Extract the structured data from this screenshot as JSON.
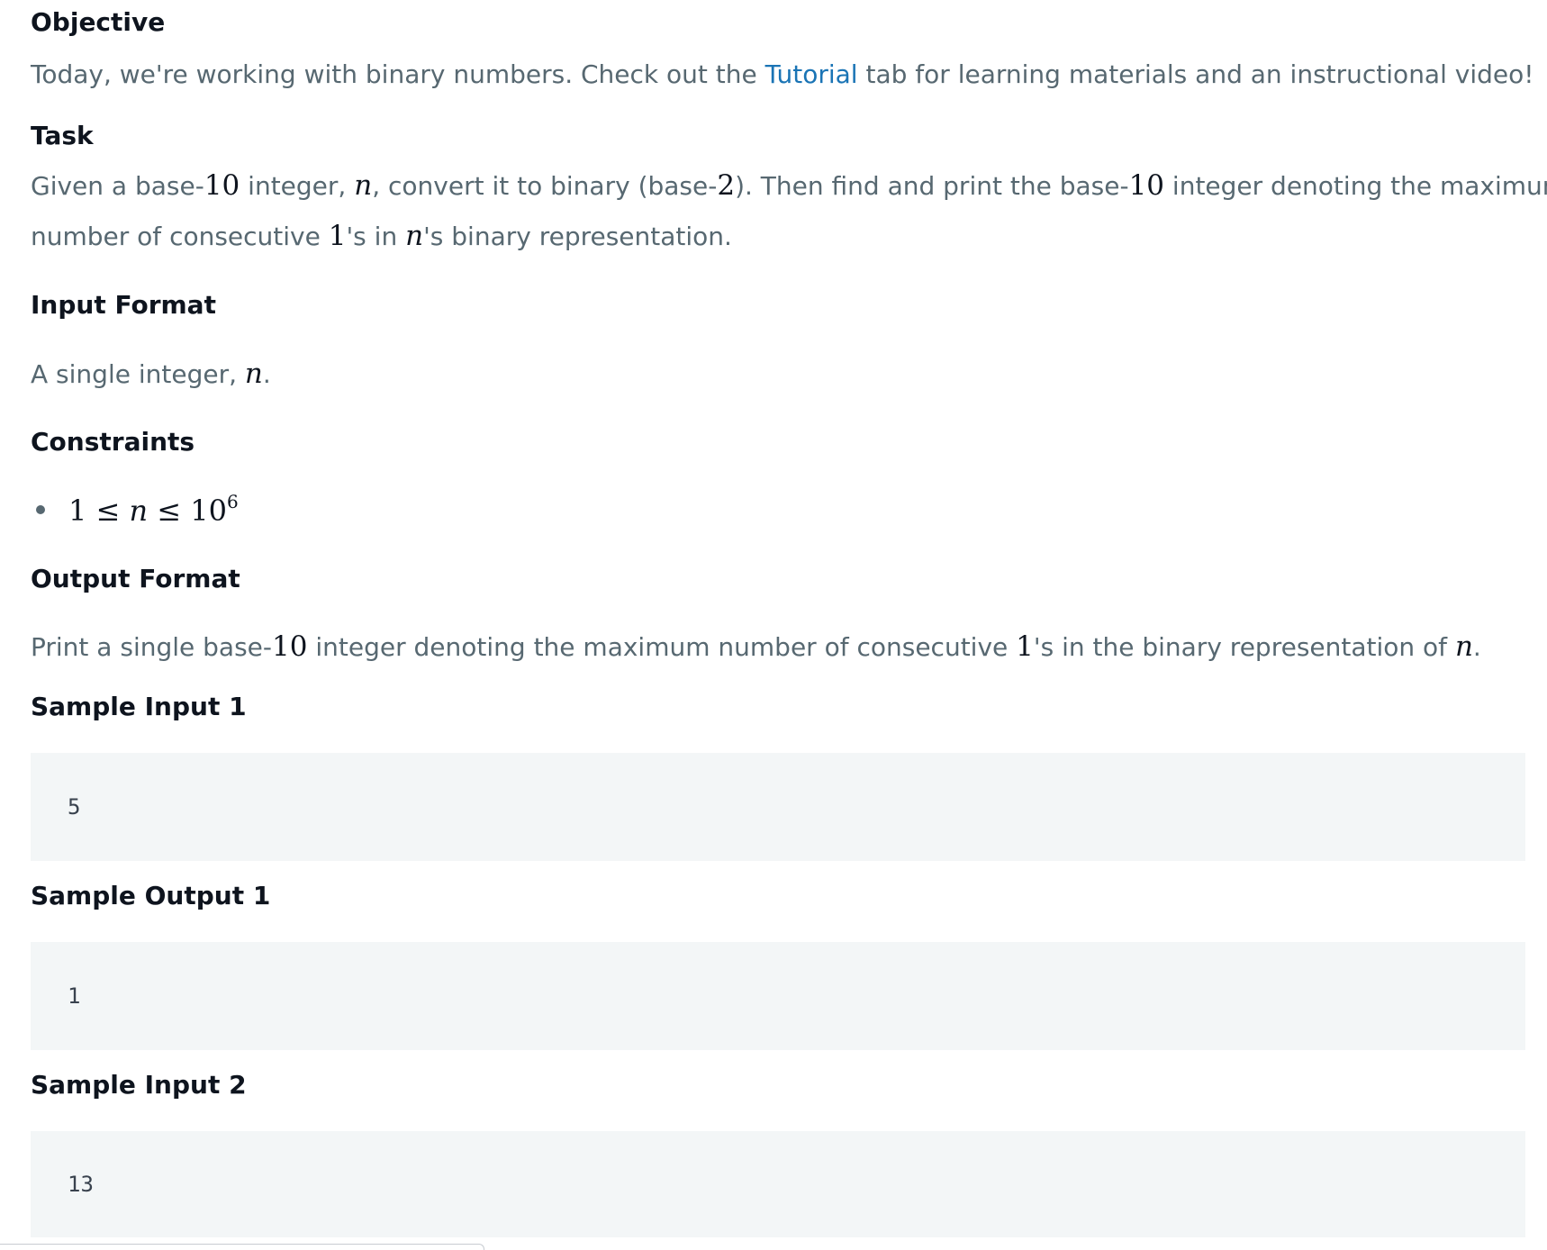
{
  "objective": {
    "heading": "Objective",
    "text_before": "Today, we're working with binary numbers. Check out the ",
    "link": "Tutorial",
    "text_after": " tab for learning materials and an instructional video!"
  },
  "task": {
    "heading": "Task",
    "line1": {
      "a": "Given a base-",
      "m1": "10",
      "b": " integer, ",
      "m2": "n",
      "c": ", convert it to binary (base-",
      "m3": "2",
      "d": "). Then find and print the base-",
      "m4": "10",
      "e": " integer denoting the maximum"
    },
    "line2": {
      "a": "number of consecutive ",
      "m1": "1",
      "b": "'s in ",
      "m2": "n",
      "c": "'s binary representation."
    }
  },
  "input_format": {
    "heading": "Input Format",
    "a": "A single integer, ",
    "m1": "n",
    "b": "."
  },
  "constraints": {
    "heading": "Constraints",
    "item": {
      "lhs": "1 ≤ ",
      "var": "n",
      "rhs": " ≤ 10",
      "exp": "6"
    }
  },
  "output_format": {
    "heading": "Output Format",
    "a": "Print a single base-",
    "m1": "10",
    "b": " integer denoting the maximum number of consecutive ",
    "m2": "1",
    "c": "'s in the binary representation of ",
    "m3": "n",
    "d": "."
  },
  "samples": [
    {
      "heading": "Sample Input 1",
      "value": "5"
    },
    {
      "heading": "Sample Output 1",
      "value": "1"
    },
    {
      "heading": "Sample Input 2",
      "value": "13"
    }
  ]
}
